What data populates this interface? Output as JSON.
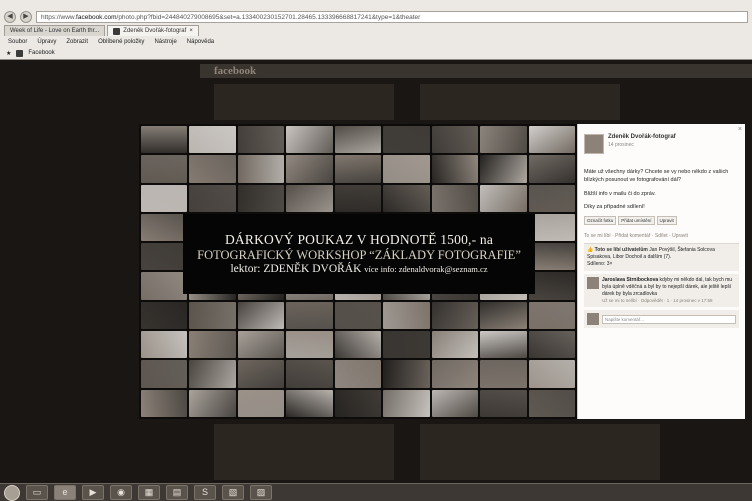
{
  "browser": {
    "url_prefix": "https://www.",
    "url_domain": "facebook.com",
    "url_rest": "/photo.php?fbid=244840279008695&set=a.133400230152701.28465.133396668817241&type=1&theater",
    "tabs": [
      "Week of Life - Love on Earth thr...",
      "Zdeněk Dvořák-fotograf"
    ],
    "close_glyph": "×",
    "menu": [
      "Soubor",
      "Úpravy",
      "Zobrazit",
      "Oblíbené položky",
      "Nástroje",
      "Nápověda"
    ],
    "favorites": [
      "Facebook"
    ]
  },
  "background": {
    "logo": "facebook"
  },
  "photo": {
    "line1": "DÁRKOVÝ POUKAZ V HODNOTĚ 1500,- na",
    "line2": "FOTOGRAFICKÝ WORKSHOP “ZÁKLADY FOTOGRAFIE”",
    "line3_main": "lektor: ZDENĚK DVOŘÁK",
    "line3_small": "více info: zdenaldvorak@seznam.cz"
  },
  "panel": {
    "close": "×",
    "name": "Zdeněk Dvořák-fotograf",
    "date": "14 prosinec",
    "paragraphs": [
      "Máte už všechny dárky? Chcete se vy nebo někdo z vašich blízkých posunout ve fotografování dál?",
      "Bližší info v mailu či do zpráv.",
      "Díky za případné sdílení!"
    ],
    "actions": [
      "Označit fotku",
      "Přidat umístění",
      "Upravit"
    ],
    "like_line": "To se mi líbí · Přidat komentář · Sdílet · Upravit",
    "likes": {
      "prefix": "Toto se líbí uživatelům",
      "names": "Jan Povýšil, Štefania Solcova Spisakova, Libor Dochoil",
      "suffix": "a dalším (7)."
    },
    "shares": "Sdíleno: 3×",
    "comment": {
      "author": "Jaroslava Strnibockova",
      "text": "kdyby mi někdo dal, tak bych mu byla úplně vděčná a byl by to nejepší dárek, ale ještě lepší dárek by byla zrcadlovka",
      "meta": "Už se mi to nelíbí · Odpovědět · 1 · 14 prosinec v 17:58"
    },
    "write_placeholder": "Napište komentář..."
  },
  "colors": {
    "page_bg": "#1a1613",
    "panel_bg": "#fdfcfb",
    "photo_band": "#050505"
  }
}
